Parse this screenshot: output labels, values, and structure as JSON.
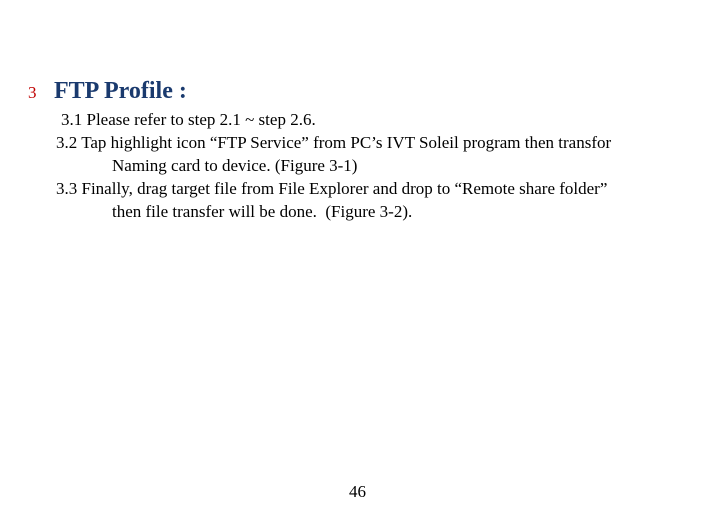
{
  "section": {
    "number": "3",
    "title": "FTP Profile :"
  },
  "lines": {
    "l31": "3.1 Please refer to step 2.1 ~ step 2.6.",
    "l32a": "3.2 Tap highlight icon “FTP Service” from PC’s IVT Soleil program then transfor",
    "l32b": "Naming card to device. (Figure 3-1)",
    "l33a": "3.3 Finally, drag target file from File Explorer and drop to “Remote share folder”",
    "l33b": "then file transfer will be done.  (Figure 3-2)."
  },
  "page_number": "46"
}
